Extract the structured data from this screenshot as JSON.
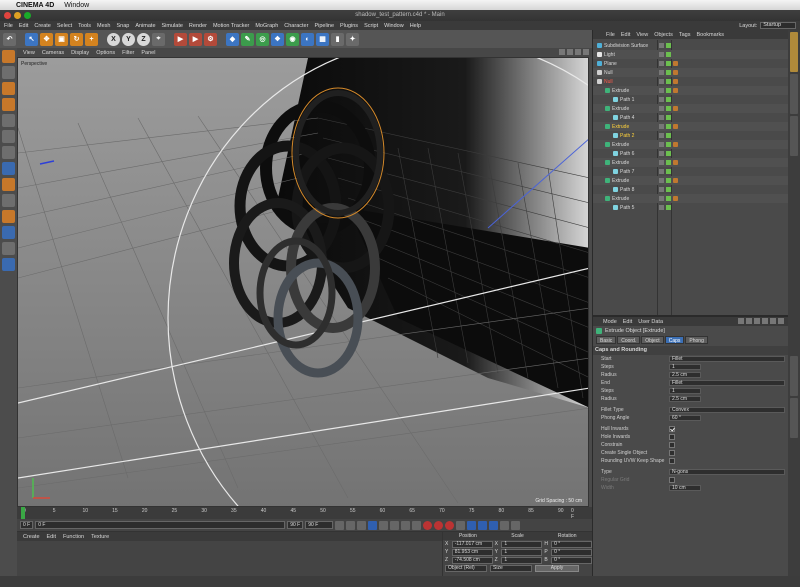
{
  "os": {
    "apple": "",
    "app_name": "CINEMA 4D",
    "menu": "Window"
  },
  "window": {
    "title": "shadow_test_pattern.c4d * - Main"
  },
  "menubar": [
    "File",
    "Edit",
    "Create",
    "Select",
    "Tools",
    "Mesh",
    "Snap",
    "Animate",
    "Simulate",
    "Render",
    "Motion Tracker",
    "MoGraph",
    "Character",
    "Pipeline",
    "Plugins",
    "Script",
    "Window",
    "Help"
  ],
  "layout": {
    "label": "Layout:",
    "value": "Startup"
  },
  "viewport": {
    "menu": [
      "View",
      "Cameras",
      "Display",
      "Options",
      "Filter",
      "Panel"
    ],
    "label": "Perspective",
    "grid_spacing": "Grid Spacing : 50 cm"
  },
  "timeline": {
    "ticks": [
      "0",
      "5",
      "10",
      "15",
      "20",
      "25",
      "30",
      "35",
      "40",
      "45",
      "50",
      "55",
      "60",
      "65",
      "70",
      "75",
      "80",
      "85",
      "90"
    ],
    "end": "0 F"
  },
  "transport": {
    "start": "0 F",
    "current": "0 F",
    "end": "90 F",
    "range_end": "90 F"
  },
  "materials": {
    "menu": [
      "Create",
      "Edit",
      "Function",
      "Texture"
    ]
  },
  "coordinates": {
    "headers": [
      "Position",
      "Scale",
      "Rotation"
    ],
    "rows": [
      {
        "axis": "X",
        "pos": "-117.017 cm",
        "scale_axis": "X",
        "scale": "1",
        "rot_axis": "H",
        "rot": "0 °"
      },
      {
        "axis": "Y",
        "pos": "81.953 cm",
        "scale_axis": "Y",
        "scale": "1",
        "rot_axis": "P",
        "rot": "0 °"
      },
      {
        "axis": "Z",
        "pos": "-74.508 cm",
        "scale_axis": "Z",
        "scale": "1",
        "rot_axis": "B",
        "rot": "0 °"
      }
    ],
    "mode": "Object (Rel)",
    "size_mode": "Size",
    "apply": "Apply"
  },
  "object_manager": {
    "menu": [
      "File",
      "Edit",
      "View",
      "Objects",
      "Tags",
      "Bookmarks"
    ],
    "objects": [
      {
        "name": "Subdivision Surface",
        "indent": 0,
        "color": "#4fb0d8",
        "style": ""
      },
      {
        "name": "Light",
        "indent": 0,
        "color": "#e8e8e8",
        "style": ""
      },
      {
        "name": "Plane",
        "indent": 0,
        "color": "#4fb0d8",
        "style": ""
      },
      {
        "name": "Null",
        "indent": 0,
        "color": "#d0d0d0",
        "style": ""
      },
      {
        "name": "Null",
        "indent": 0,
        "color": "#d0d0d0",
        "style": "red"
      },
      {
        "name": "Extrude",
        "indent": 1,
        "color": "#3fb37a",
        "style": ""
      },
      {
        "name": "Path 1",
        "indent": 2,
        "color": "#7fd3e0",
        "style": ""
      },
      {
        "name": "Extrude",
        "indent": 1,
        "color": "#3fb37a",
        "style": ""
      },
      {
        "name": "Path 4",
        "indent": 2,
        "color": "#7fd3e0",
        "style": ""
      },
      {
        "name": "Extrude",
        "indent": 1,
        "color": "#3fb37a",
        "style": "hl"
      },
      {
        "name": "Path 2",
        "indent": 2,
        "color": "#7fd3e0",
        "style": "hl"
      },
      {
        "name": "Extrude",
        "indent": 1,
        "color": "#3fb37a",
        "style": ""
      },
      {
        "name": "Path 6",
        "indent": 2,
        "color": "#7fd3e0",
        "style": ""
      },
      {
        "name": "Extrude",
        "indent": 1,
        "color": "#3fb37a",
        "style": ""
      },
      {
        "name": "Path 7",
        "indent": 2,
        "color": "#7fd3e0",
        "style": ""
      },
      {
        "name": "Extrude",
        "indent": 1,
        "color": "#3fb37a",
        "style": ""
      },
      {
        "name": "Path 8",
        "indent": 2,
        "color": "#7fd3e0",
        "style": ""
      },
      {
        "name": "Extrude",
        "indent": 1,
        "color": "#3fb37a",
        "style": ""
      },
      {
        "name": "Path 5",
        "indent": 2,
        "color": "#7fd3e0",
        "style": ""
      }
    ]
  },
  "attribute_manager": {
    "menu": [
      "Mode",
      "Edit",
      "User Data"
    ],
    "title": "Extrude Object [Extrude]",
    "tabs": [
      "Basic",
      "Coord.",
      "Object",
      "Caps",
      "Phong"
    ],
    "active_tab": "Caps",
    "section": "Caps and Rounding",
    "props": [
      {
        "label": "Start",
        "type": "select",
        "value": "Fillet"
      },
      {
        "label": "Steps",
        "type": "num",
        "value": "1"
      },
      {
        "label": "Radius",
        "type": "num",
        "value": "2.5 cm"
      },
      {
        "label": "End",
        "type": "select",
        "value": "Fillet"
      },
      {
        "label": "Steps",
        "type": "num",
        "value": "1"
      },
      {
        "label": "Radius",
        "type": "num",
        "value": "2.5 cm"
      },
      {
        "label": "Fillet Type",
        "type": "select",
        "value": "Convex",
        "gap": true
      },
      {
        "label": "Phong Angle",
        "type": "num",
        "value": "60 °"
      },
      {
        "label": "Hull Inwards",
        "type": "check",
        "value": "on",
        "gap": true
      },
      {
        "label": "Hole Inwards",
        "type": "check",
        "value": "off"
      },
      {
        "label": "Constrain",
        "type": "check",
        "value": "off"
      },
      {
        "label": "Create Single Object",
        "type": "check",
        "value": "off"
      },
      {
        "label": "Rounding UVW Keep Shape",
        "type": "check",
        "value": "off"
      },
      {
        "label": "Type",
        "type": "select",
        "value": "N-gons",
        "gap": true
      },
      {
        "label": "Regular Grid",
        "type": "check",
        "value": "off",
        "dim": true
      },
      {
        "label": "Width",
        "type": "num",
        "value": "10 cm",
        "dim": true
      }
    ]
  }
}
